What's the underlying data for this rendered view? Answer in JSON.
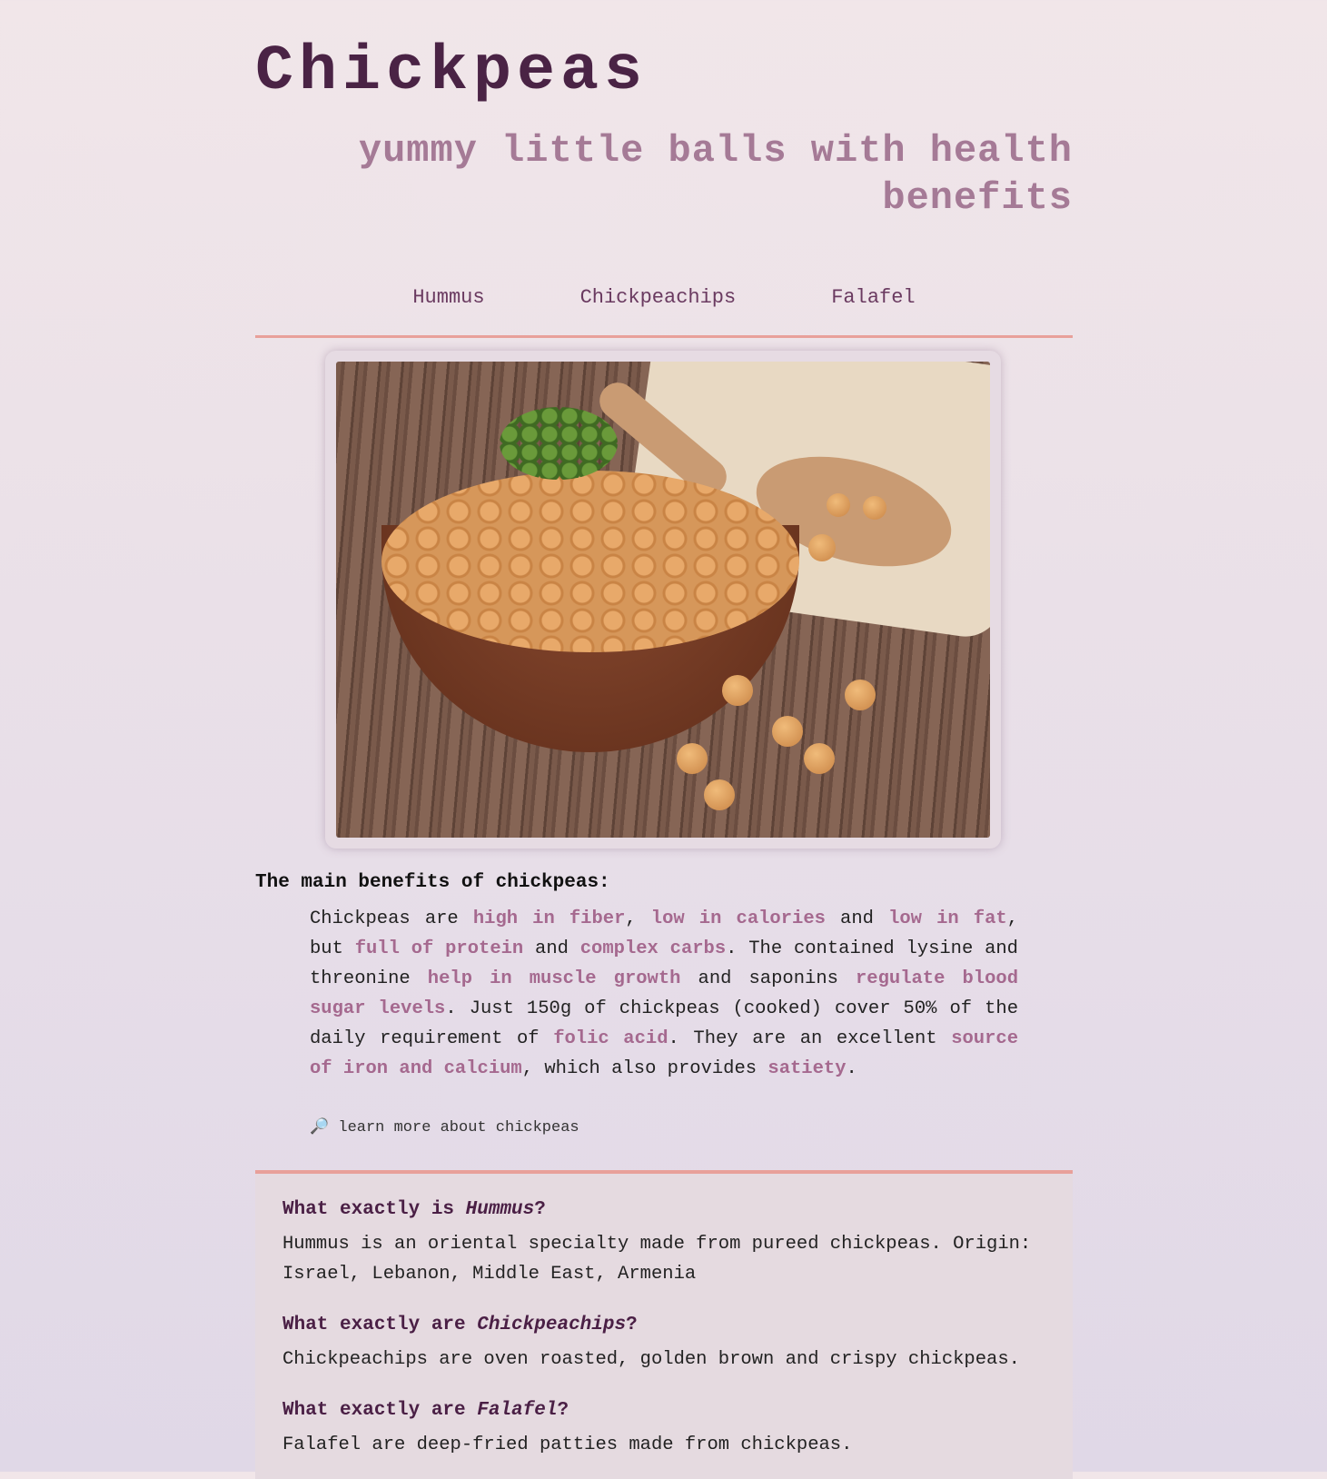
{
  "header": {
    "title": "Chickpeas",
    "subtitle": "yummy little balls with health benefits"
  },
  "nav": [
    "Hummus",
    "Chickpeachips",
    "Falafel"
  ],
  "image": {
    "alt": "bowl of chickpeas on wooden table"
  },
  "benefits": {
    "heading": "The main benefits of chickpeas:",
    "parts": [
      "Chickpeas are ",
      "high in fiber",
      ", ",
      "low in calories",
      " and ",
      "low in fat",
      ", but ",
      "full of protein",
      " and ",
      "complex carbs",
      ". The contained lysine and threonine ",
      "help in muscle growth",
      " and saponins ",
      "regulate blood sugar levels",
      ". Just 150g of chickpeas (cooked) cover 50% of the daily requirement of ",
      "folic acid",
      ". They are an excellent ",
      "source of iron and calcium",
      ", which also provides ",
      "satiety",
      "."
    ],
    "learn_more": "learn more about chickpeas"
  },
  "faq": [
    {
      "q_prefix": "What exactly is ",
      "q_term": "Hummus",
      "q_suffix": "?",
      "a": "Hummus is an oriental specialty made from pureed chickpeas. Origin: Israel, Lebanon, Middle East, Armenia"
    },
    {
      "q_prefix": "What exactly are ",
      "q_term": "Chickpeachips",
      "q_suffix": "?",
      "a": "Chickpeachips are oven roasted, golden brown and crispy chickpeas."
    },
    {
      "q_prefix": "What exactly are ",
      "q_term": "Falafel",
      "q_suffix": "?",
      "a": "Falafel are deep-fried patties made from chickpeas."
    }
  ]
}
